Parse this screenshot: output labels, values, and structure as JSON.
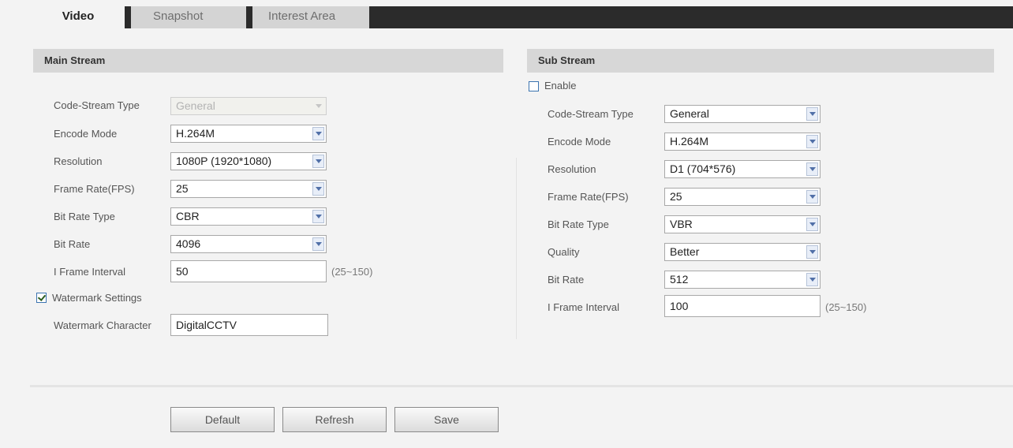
{
  "tabs": [
    {
      "label": "Video",
      "active": true
    },
    {
      "label": "Snapshot",
      "active": false
    },
    {
      "label": "Interest Area",
      "active": false
    }
  ],
  "main": {
    "title": "Main Stream",
    "code_stream_type": {
      "label": "Code-Stream Type",
      "value": "General"
    },
    "encode_mode": {
      "label": "Encode Mode",
      "value": "H.264M"
    },
    "resolution": {
      "label": "Resolution",
      "value": "1080P (1920*1080)"
    },
    "frame_rate": {
      "label": "Frame Rate(FPS)",
      "value": "25"
    },
    "bit_rate_type": {
      "label": "Bit Rate Type",
      "value": "CBR"
    },
    "bit_rate": {
      "label": "Bit Rate",
      "value": "4096"
    },
    "iframe": {
      "label": "I Frame Interval",
      "value": "50",
      "range": "(25~150)"
    },
    "watermark_settings": {
      "label": "Watermark Settings",
      "checked": true
    },
    "watermark_character": {
      "label": "Watermark Character",
      "value": "DigitalCCTV"
    }
  },
  "sub": {
    "title": "Sub Stream",
    "enable": {
      "label": "Enable",
      "checked": false
    },
    "code_stream_type": {
      "label": "Code-Stream Type",
      "value": "General"
    },
    "encode_mode": {
      "label": "Encode Mode",
      "value": "H.264M"
    },
    "resolution": {
      "label": "Resolution",
      "value": "D1 (704*576)"
    },
    "frame_rate": {
      "label": "Frame Rate(FPS)",
      "value": "25"
    },
    "bit_rate_type": {
      "label": "Bit Rate Type",
      "value": "VBR"
    },
    "quality": {
      "label": "Quality",
      "value": "Better"
    },
    "bit_rate": {
      "label": "Bit Rate",
      "value": "512"
    },
    "iframe": {
      "label": "I Frame Interval",
      "value": "100",
      "range": "(25~150)"
    }
  },
  "buttons": {
    "default": "Default",
    "refresh": "Refresh",
    "save": "Save"
  },
  "icons": {
    "dropdown": "chevron-down-icon",
    "checkbox": "checkbox-icon"
  },
  "colors": {
    "tab_strip": "#2b2b2b",
    "section_header": "#d7d7d7",
    "accent": "#3c74b0"
  }
}
